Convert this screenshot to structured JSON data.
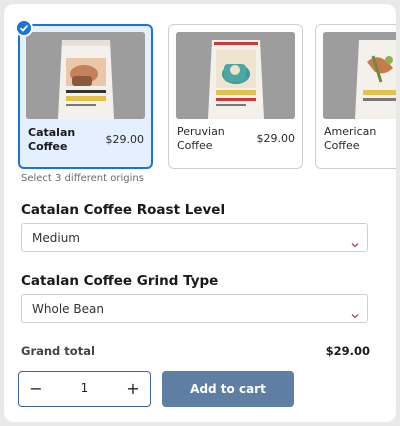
{
  "products": [
    {
      "name": "Catalan Coffee",
      "price": "$29.00",
      "selected": true
    },
    {
      "name": "Peruvian Coffee",
      "price": "$29.00",
      "selected": false
    },
    {
      "name": "American Coffee",
      "price": "",
      "selected": false
    }
  ],
  "helper_text": "Select 3 different origins",
  "roast": {
    "label": "Catalan Coffee Roast Level",
    "value": "Medium"
  },
  "grind": {
    "label": "Catalan Coffee Grind Type",
    "value": "Whole Bean"
  },
  "total": {
    "label": "Grand total",
    "value": "$29.00"
  },
  "quantity": {
    "minus": "−",
    "value": "1",
    "plus": "+"
  },
  "cart_button": "Add to cart",
  "colors": {
    "accent": "#1b74d8",
    "button": "#5e7ea3",
    "chevron": "#b0455a"
  }
}
